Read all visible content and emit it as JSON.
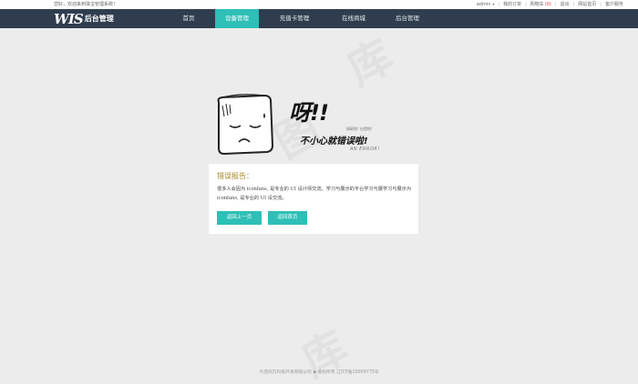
{
  "topbar": {
    "welcome": "您好，欢迎来到珠宝管理系统！",
    "user": "admin",
    "orders": "我的订单",
    "cart": "购物车",
    "cart_count": "(0)",
    "logout": "退出",
    "site": "网站首页",
    "service": "客户服务"
  },
  "header": {
    "logo_mark": "WIS",
    "logo_text": "后台管理",
    "nav": [
      "首页",
      "设备管理",
      "充值卡管理",
      "在线商城",
      "后台管理"
    ],
    "active_index": 1
  },
  "error": {
    "exclaim": "呀!!",
    "hint": "搞砸啦!  出错啦!",
    "headline": "不小心就错误啦!",
    "subline": "AN ERROR!"
  },
  "panel": {
    "title": "错误报告：",
    "description": "很多人会因为 iconfans, 是专业的 UI 设计师交流、学习与展示的平台学习与展学习与展示为 iconfans, 是专业的 UI 设交流。",
    "back_button": "返回上一页",
    "home_button": "返回首页"
  },
  "footer": {
    "text": "大连同方科技开发有限公司 ◆ 版权所有 辽ICP备10009775号"
  },
  "colors": {
    "accent": "#2ebfb7",
    "header_bg": "#2f3d4f",
    "page_bg": "#ececec"
  }
}
